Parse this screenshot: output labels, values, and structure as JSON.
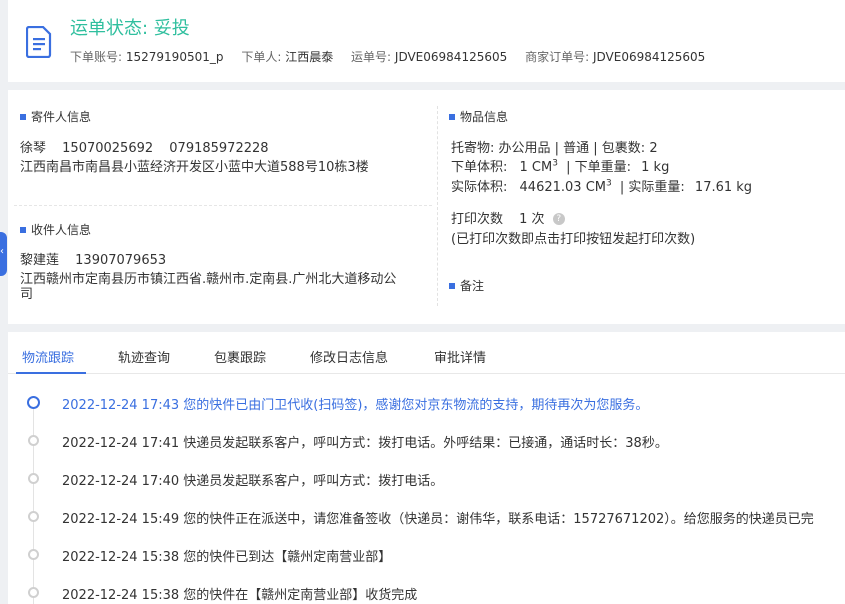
{
  "header": {
    "status_label": "运单状态: 妥投",
    "account_label": "下单账号:",
    "account_value": "15279190501_p",
    "orderer_label": "下单人:",
    "orderer_value": "江西晨泰",
    "waybill_label": "运单号:",
    "waybill_value": "JDVE06984125605",
    "merchant_label": "商家订单号:",
    "merchant_value": "JDVE06984125605",
    "status_color": "#2fbf9e",
    "icon": "document-icon"
  },
  "sender": {
    "title": "寄件人信息",
    "name": "徐琴",
    "phone1": "15070025692",
    "phone2": "079185972228",
    "address": "江西南昌市南昌县小蓝经济开发区小蓝中大道588号10栋3楼"
  },
  "receiver": {
    "title": "收件人信息",
    "name": "黎建莲",
    "phone": "13907079653",
    "address_line1": "江西赣州市定南县历市镇江西省.赣州市.定南县.广州北大道移动公",
    "address_line2": "司"
  },
  "goods": {
    "title": "物品信息",
    "line1": "托寄物:  办公用品 | 普通  |  包裹数:  2",
    "order_volume_label": "下单体积:",
    "order_volume_value": "1 CM",
    "order_weight_label": "|  下单重量:",
    "order_weight_value": "1 kg",
    "actual_volume_label": "实际体积:",
    "actual_volume_value": "44621.03 CM",
    "actual_weight_label": "|  实际重量:",
    "actual_weight_value": "17.61 kg",
    "superscript": "3",
    "print_label": "打印次数",
    "print_value": "1 次",
    "print_note": "(已打印次数即点击打印按钮发起打印次数)",
    "help_glyph": "?"
  },
  "remark": {
    "title": "备注"
  },
  "side_tab_glyph": "‹",
  "tabs": [
    {
      "label": "物流跟踪"
    },
    {
      "label": "轨迹查询"
    },
    {
      "label": "包裹跟踪"
    },
    {
      "label": "修改日志信息"
    },
    {
      "label": "审批详情"
    }
  ],
  "timeline": [
    {
      "text": "2022-12-24 17:43 您的快件已由门卫代收(扫码签)，感谢您对京东物流的支持，期待再次为您服务。"
    },
    {
      "text": "2022-12-24 17:41 快递员发起联系客户，呼叫方式：拨打电话。外呼结果：已接通，通话时长：38秒。"
    },
    {
      "text": "2022-12-24 17:40 快递员发起联系客户，呼叫方式：拨打电话。"
    },
    {
      "text": "2022-12-24 15:49 您的快件正在派送中，请您准备签收（快递员：谢伟华，联系电话：15727671202）。给您服务的快递员已完"
    },
    {
      "text": "2022-12-24 15:38 您的快件已到达【赣州定南营业部】"
    },
    {
      "text": "2022-12-24 15:38 您的快件在【赣州定南营业部】收货完成"
    }
  ],
  "colors": {
    "accent": "#3a6fe0",
    "status": "#2fbf9e"
  }
}
